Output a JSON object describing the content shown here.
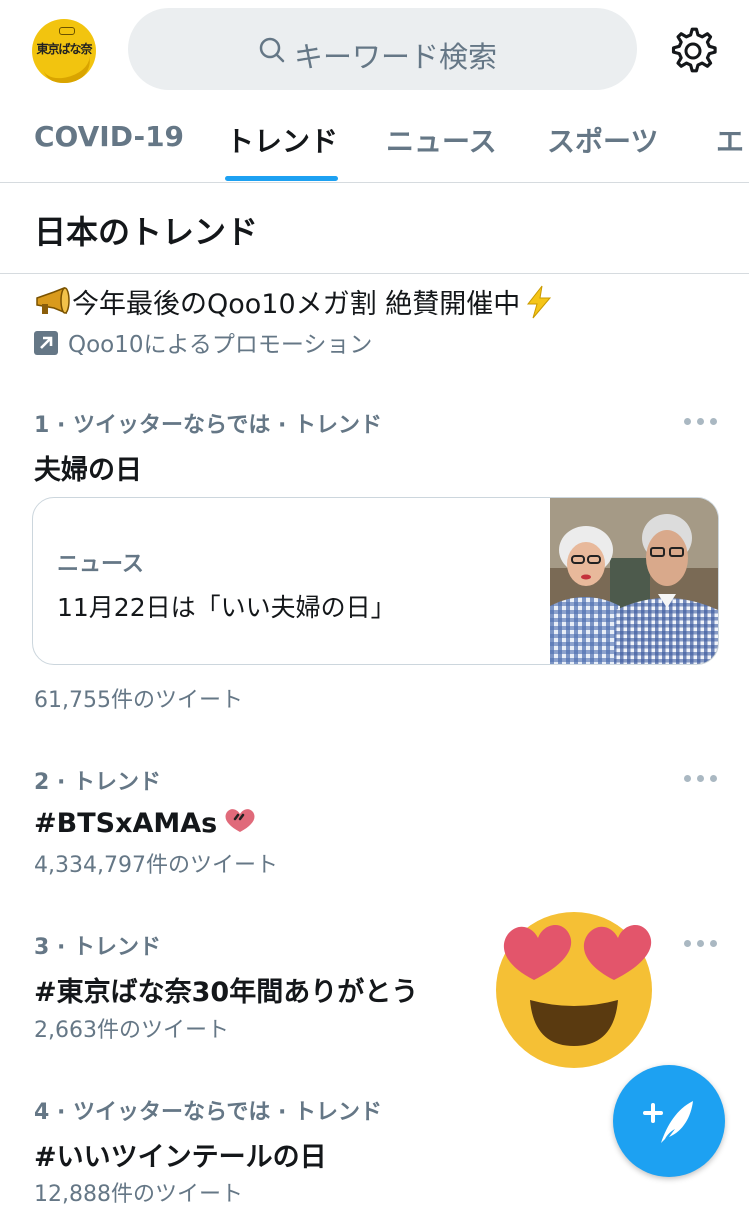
{
  "header": {
    "avatar_text": "東京ばな奈",
    "search": {
      "placeholder": "キーワード検索"
    }
  },
  "tabs": [
    {
      "label": "COVID-19",
      "active": false
    },
    {
      "label": "トレンド",
      "active": true
    },
    {
      "label": "ニュース",
      "active": false
    },
    {
      "label": "スポーツ",
      "active": false
    },
    {
      "label": "エ",
      "active": false
    }
  ],
  "section_title": "日本のトレンド",
  "promo": {
    "text": "今年最後のQoo10メガ割 絶賛開催中",
    "meta": "Qoo10によるプロモーション"
  },
  "trends": [
    {
      "meta": "1 · ツイッターならでは · トレンド",
      "name": "夫婦の日",
      "news": {
        "category": "ニュース",
        "title": "11月22日は「いい夫婦の日」"
      },
      "count": "61,755件のツイート"
    },
    {
      "meta": "2 · トレンド",
      "name": "#BTSxAMAs",
      "count": "4,334,797件のツイート"
    },
    {
      "meta": "3 · トレンド",
      "name": "#東京ばな奈30年間ありがとう",
      "count": "2,663件のツイート"
    },
    {
      "meta": "4 · ツイッターならでは · トレンド",
      "name": "#いいツインテールの日",
      "count": "12,888件のツイート"
    }
  ],
  "icons": {
    "search": "search-icon",
    "settings": "gear-icon",
    "promo_emoji": "megaphone-icon",
    "promo_suffix": "lightning-icon",
    "promoted": "promoted-arrow-icon",
    "more": "more-icon",
    "compose": "compose-tweet-icon",
    "sticker": "heart-eyes-emoji"
  },
  "colors": {
    "accent": "#1da1f2",
    "text_secondary": "#657786",
    "divider": "#d6dbdf"
  }
}
